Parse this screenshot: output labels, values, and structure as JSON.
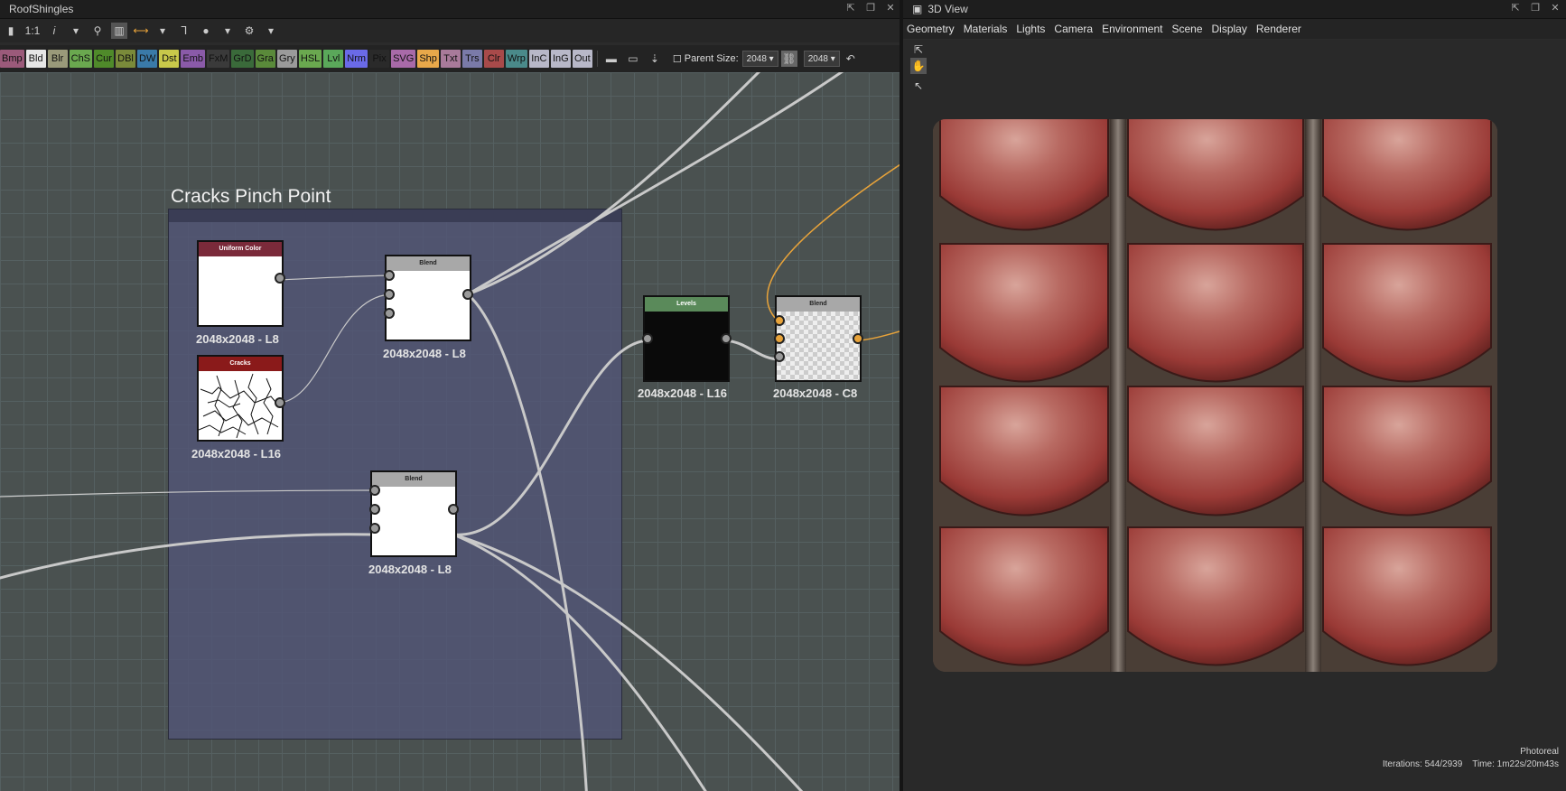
{
  "graph_panel": {
    "title": "RoofShingles",
    "toolbar": {
      "zoom_label": "1:1",
      "info_icon": "i"
    }
  },
  "atoms": [
    {
      "label": "Bmp",
      "color": "#9b5a7a"
    },
    {
      "label": "Bld",
      "color": "#e6e6e6"
    },
    {
      "label": "Blr",
      "color": "#9a9a7a"
    },
    {
      "label": "ChS",
      "color": "#6aa84f"
    },
    {
      "label": "Cur",
      "color": "#4f8a2a"
    },
    {
      "label": "DBl",
      "color": "#7a8a3a"
    },
    {
      "label": "DW",
      "color": "#3a7aa8"
    },
    {
      "label": "Dst",
      "color": "#c8c84a"
    },
    {
      "label": "Emb",
      "color": "#8a5aa8"
    },
    {
      "label": "FxM",
      "color": "#3a3a3a"
    },
    {
      "label": "GrD",
      "color": "#3a6a3a"
    },
    {
      "label": "Gra",
      "color": "#5a8a3a"
    },
    {
      "label": "Gry",
      "color": "#9a9a9a"
    },
    {
      "label": "HSL",
      "color": "#6aa84f"
    },
    {
      "label": "Lvl",
      "color": "#5aa85a"
    },
    {
      "label": "Nrm",
      "color": "#6a6ae8"
    },
    {
      "label": "Pix",
      "color": "#2a2a2a"
    },
    {
      "label": "SVG",
      "color": "#a86aa8"
    },
    {
      "label": "Shp",
      "color": "#e8a84a"
    },
    {
      "label": "Txt",
      "color": "#a87a9a"
    },
    {
      "label": "Trs",
      "color": "#7a7aa8"
    },
    {
      "label": "Clr",
      "color": "#a84a4a"
    },
    {
      "label": "Wrp",
      "color": "#4a8a8a"
    },
    {
      "label": "InC",
      "color": "#b8b8c8"
    },
    {
      "label": "InG",
      "color": "#b8b8c8"
    },
    {
      "label": "Out",
      "color": "#b8b8c8"
    }
  ],
  "parent_size": {
    "label": "Parent Size:",
    "value": "2048",
    "value2": "2048"
  },
  "frame": {
    "title": "Cracks Pinch Point"
  },
  "nodes": {
    "uniform": {
      "title": "Uniform Color",
      "label": "2048x2048 - L8",
      "header_color": "#7a2a3a"
    },
    "cracks": {
      "title": "Cracks",
      "label": "2048x2048 - L16",
      "header_color": "#8a1a1a"
    },
    "blend1": {
      "title": "Blend",
      "label": "2048x2048 - L8",
      "header_color": "#a8a8a8"
    },
    "blend2": {
      "title": "Blend",
      "label": "2048x2048 - L8",
      "header_color": "#a8a8a8"
    },
    "levels": {
      "title": "Levels",
      "label": "2048x2048 - L16",
      "header_color": "#5a8a5a"
    },
    "blend3": {
      "title": "Blend",
      "label": "2048x2048 - C8",
      "header_color": "#a8a8a8"
    }
  },
  "view_panel": {
    "title": "3D View",
    "menu": [
      "Geometry",
      "Materials",
      "Lights",
      "Camera",
      "Environment",
      "Scene",
      "Display",
      "Renderer"
    ],
    "render_mode": "Photoreal",
    "iterations": "Iterations: 544/2939",
    "time": "Time: 1m22s/20m43s"
  }
}
